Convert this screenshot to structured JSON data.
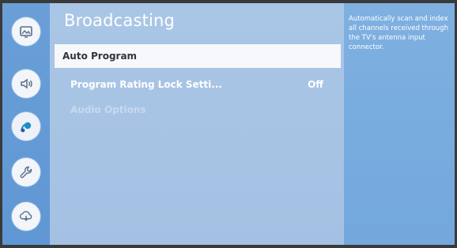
{
  "sidebar": {
    "items": [
      {
        "icon": "picture-icon"
      },
      {
        "icon": "sound-icon"
      },
      {
        "icon": "broadcasting-icon",
        "active": true
      },
      {
        "icon": "wrench-icon"
      },
      {
        "icon": "support-icon"
      }
    ]
  },
  "main": {
    "title": "Broadcasting",
    "items": [
      {
        "label": "Auto Program",
        "value": "",
        "state": "selected"
      },
      {
        "label": "Program Rating Lock Setti...",
        "value": "Off",
        "state": "normal"
      },
      {
        "label": "Audio Options",
        "value": "",
        "state": "disabled"
      }
    ]
  },
  "description": {
    "text": "Automatically scan and index all channels received through the TV's antenna input connector."
  },
  "colors": {
    "sidebar": "#6a9fd8",
    "main": "#aac6e6",
    "description_panel": "#7fb0e0",
    "selected_row": "#f6f8fb",
    "accent_icon": "#1f8fc4"
  }
}
